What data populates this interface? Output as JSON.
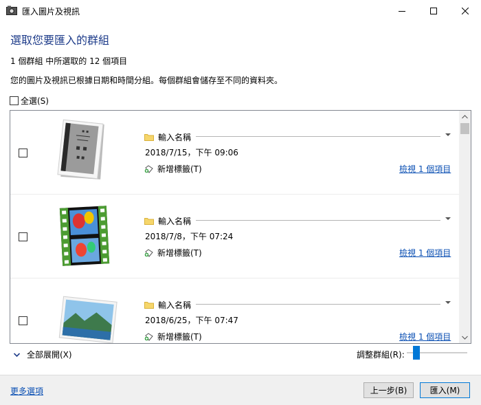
{
  "window": {
    "title": "匯入圖片及視訊",
    "icon": "camera-icon",
    "controls": [
      "minimize-icon",
      "maximize-icon",
      "close-icon"
    ]
  },
  "heading": "選取您要匯入的群組",
  "selection_count": "1 個群組 中所選取的 12 個項目",
  "description": "您的圖片及視訊已根據日期和時間分組。每個群組會儲存至不同的資料夾。",
  "select_all_label": "全選(S)",
  "groups": [
    {
      "name_placeholder": "輸入名稱",
      "date": "2018/7/15，下午 09:06",
      "tag_label": "新增標籤(T)",
      "view_link": "檢視 1 個項目",
      "thumbnail": "document-photo"
    },
    {
      "name_placeholder": "輸入名稱",
      "date": "2018/7/8，下午 07:24",
      "tag_label": "新增標籤(T)",
      "view_link": "檢視 1 個項目",
      "thumbnail": "video-filmstrip"
    },
    {
      "name_placeholder": "輸入名稱",
      "date": "2018/6/25，下午 07:47",
      "tag_label": "新增標籤(T)",
      "view_link": "檢視 1 個項目",
      "thumbnail": "landscape-photo"
    }
  ],
  "expand_all_label": "全部展開(X)",
  "adjust_groups_label": "調整群組(R):",
  "adjust_groups_level": 0.12,
  "footer": {
    "more_options": "更多選項",
    "back_button": "上一步(B)",
    "import_button": "匯入(M)"
  },
  "colors": {
    "accent": "#0078d7",
    "heading": "#1e3c8a",
    "link": "#0a4fb3"
  }
}
